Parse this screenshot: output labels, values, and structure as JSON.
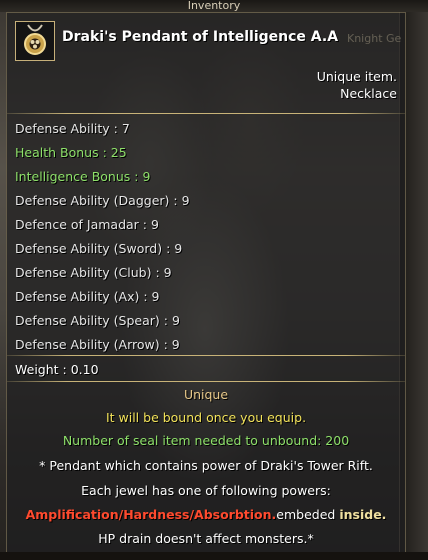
{
  "window": {
    "title": "Inventory"
  },
  "item": {
    "name": "Draki's Pendant of Intelligence A.A",
    "rarity": "Unique item.",
    "type": "Necklace",
    "icon": "pendant-icon"
  },
  "background_tag": "Knight Ge",
  "stats": [
    {
      "label": "Defense Ability : 7",
      "color": "#e6e6e6"
    },
    {
      "label": "Health Bonus : 25",
      "color": "#8ee06a"
    },
    {
      "label": "Intelligence Bonus : 9",
      "color": "#8ee06a"
    },
    {
      "label": "Defense Ability (Dagger) : 9",
      "color": "#e6e6e6"
    },
    {
      "label": "Defence of Jamadar : 9",
      "color": "#e6e6e6"
    },
    {
      "label": "Defense Ability (Sword) : 9",
      "color": "#e6e6e6"
    },
    {
      "label": "Defense Ability (Club) : 9",
      "color": "#e6e6e6"
    },
    {
      "label": "Defense Ability (Ax) : 9",
      "color": "#e6e6e6"
    },
    {
      "label": "Defense Ability (Spear) : 9",
      "color": "#e6e6e6"
    },
    {
      "label": "Defense Ability (Arrow) : 9",
      "color": "#e6e6e6"
    }
  ],
  "weight": "Weight : 0.10",
  "grade": "Unique",
  "bind_text": "It will be bound once you equip.",
  "seal_text": "Number of seal item needed to unbound: 200",
  "desc_line1": "* Pendant which contains power of Draki's Tower Rift.",
  "desc_line2": "Each jewel has one of following powers:",
  "powers": "Amplification/Hardness/Absorbtion.",
  "embeded": "embeded",
  "inside": "inside.",
  "desc_line4": "HP drain doesn't affect monsters.*"
}
